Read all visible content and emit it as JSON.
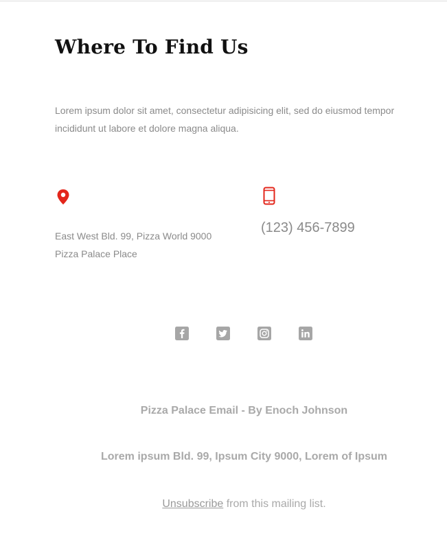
{
  "section": {
    "title": "Where To Find Us",
    "intro_line1": "Lorem ipsum dolor sit amet, consectetur adipisicing elit, sed do eiusmod tempor",
    "intro_line2": "incididunt ut labore et dolore magna aliqua."
  },
  "location": {
    "icon": "map-pin-icon",
    "address_line1": "East West Bld. 99, Pizza World 9000",
    "address_line2": "Pizza Palace Place"
  },
  "contact": {
    "icon": "mobile-phone-icon",
    "phone": "(123) 456-7899"
  },
  "social": [
    {
      "icon": "facebook-icon"
    },
    {
      "icon": "twitter-icon"
    },
    {
      "icon": "instagram-icon"
    },
    {
      "icon": "linkedin-icon"
    }
  ],
  "footer": {
    "credit": "Pizza Palace Email - By Enoch Johnson",
    "address": "Lorem ipsum Bld. 99, Ipsum City 9000, Lorem of Ipsum",
    "unsubscribe_link": "Unsubscribe",
    "unsubscribe_suffix": " from this mailing list."
  },
  "colors": {
    "accent": "#e3261b",
    "text_muted": "#8a8a8a",
    "footer_text": "#a9a9a9",
    "social_icon": "#a6a6a6",
    "heading": "#111111"
  }
}
